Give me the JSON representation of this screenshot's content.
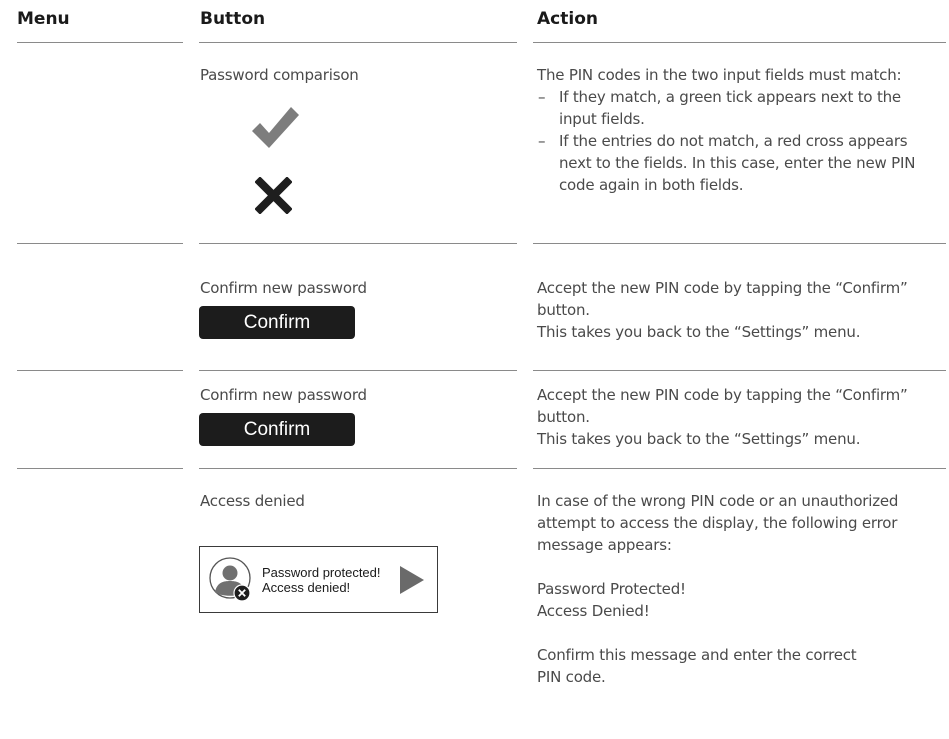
{
  "header": {
    "menu": "Menu",
    "button": "Button",
    "action": "Action"
  },
  "rows": [
    {
      "button_label": "Password comparison",
      "icons": [
        "check-icon",
        "cross-icon"
      ],
      "action_intro": "The PIN codes in the two input fields must match:",
      "bullets": [
        {
          "dash": "–",
          "lines": [
            "If they match, a green tick appears next to the",
            "input fields."
          ]
        },
        {
          "dash": "–",
          "lines": [
            "If the entries do not match, a red cross appears",
            "next to the fields. In this case, enter the new PIN",
            "code again in both fields."
          ]
        }
      ]
    },
    {
      "button_label": "Confirm new password",
      "button_text": "Confirm",
      "action_lines": [
        "Accept the new PIN code by tapping the “Confirm”",
        "button.",
        "This takes you back to the “Settings” menu."
      ]
    },
    {
      "button_label": "Confirm new password",
      "button_text": "Confirm",
      "action_lines": [
        "Accept the new PIN code by tapping the “Confirm”",
        "button.",
        "This takes you back to the “Settings” menu."
      ]
    },
    {
      "button_label": "Access denied",
      "message_box": {
        "line1": "Password protected!",
        "line2": "Access denied!",
        "icons": [
          "user-icon",
          "error-badge-icon",
          "play-arrow-icon"
        ]
      },
      "action_lines": [
        "In case of the wrong PIN code or an unauthorized",
        "attempt to access the display, the following error",
        "message appears:"
      ],
      "action_message": [
        "Password Protected!",
        "Access Denied!"
      ],
      "action_closing": [
        "Confirm this message and enter the correct",
        "PIN code."
      ]
    }
  ],
  "colors": {
    "rule": "#8a8a8a",
    "text": "#4a4a4a",
    "button_bg": "#1c1c1c",
    "check": "#7d7d7d",
    "cross": "#1e1e1e"
  }
}
